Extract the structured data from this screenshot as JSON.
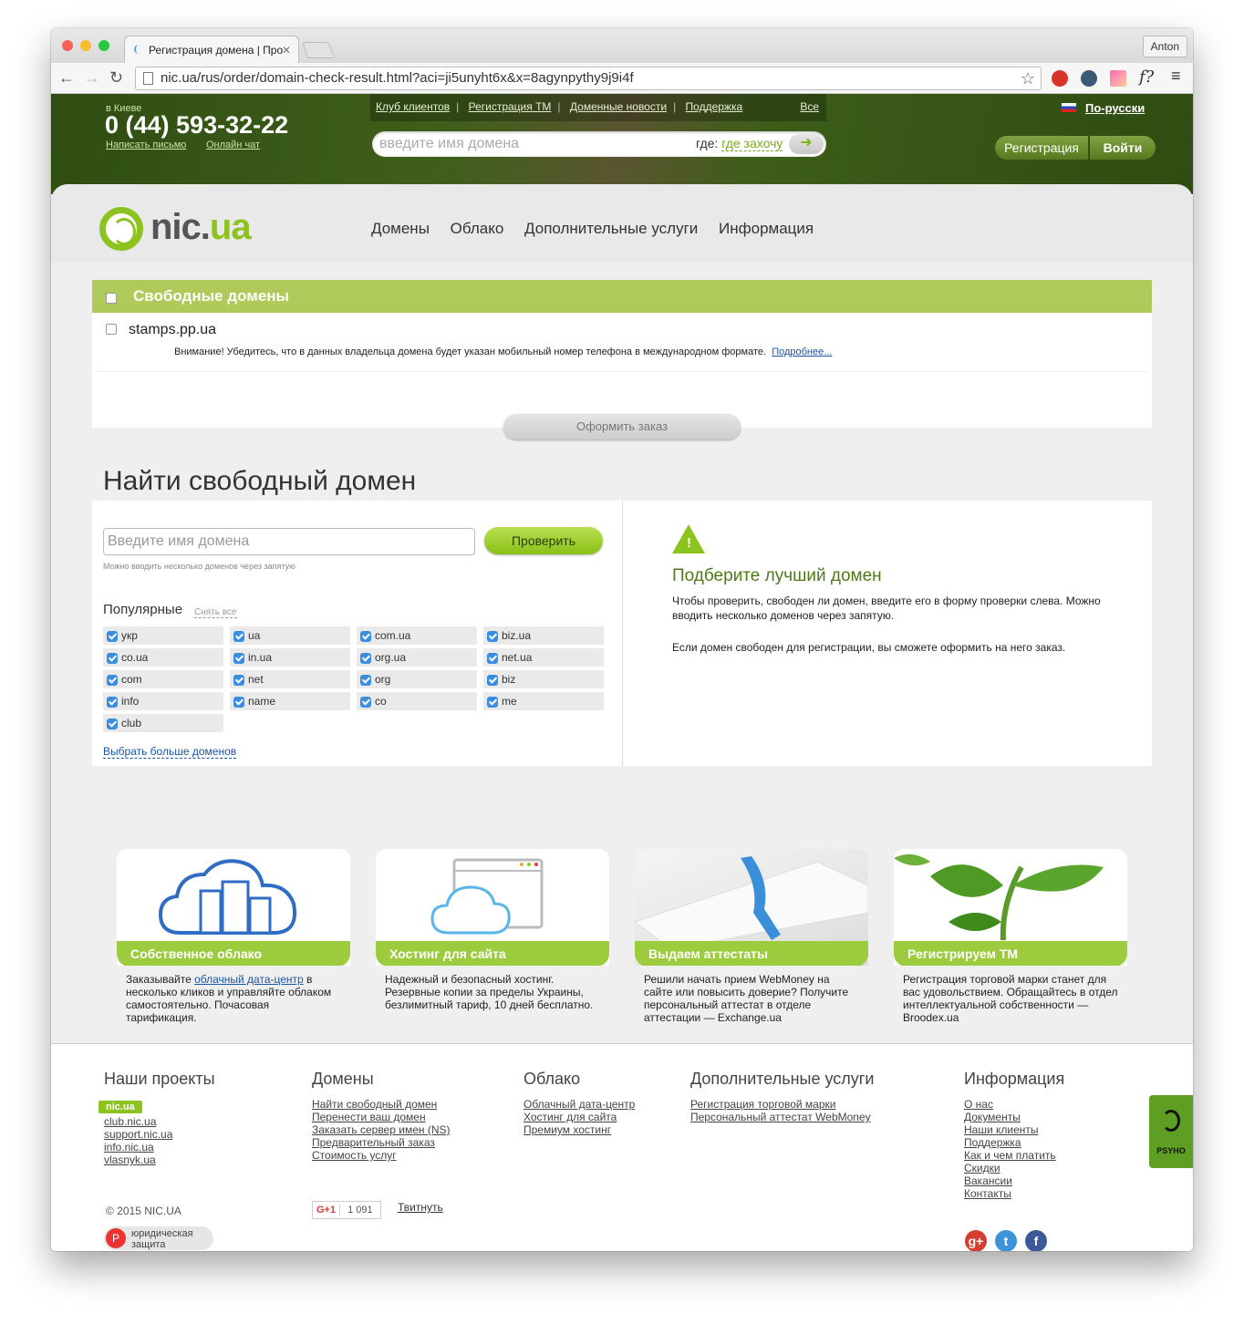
{
  "browser": {
    "tab_title": "Регистрация домена | Про",
    "user": "Anton",
    "url": "nic.ua/rus/order/domain-check-result.html?aci=ji5unyht6x&x=8agynpythy9j9i4f"
  },
  "header": {
    "city": "в Киеве",
    "phone": "0 (44) 593-32-22",
    "write_link": "Написать письмо",
    "chat_link": "Онлайн чат",
    "top_links": [
      "Клуб клиентов",
      "Регистрация ТМ",
      "Доменные новости",
      "Поддержка"
    ],
    "all_link": "Все",
    "search_placeholder": "введите имя домена",
    "where_label": "где:",
    "where_value": "где захочу",
    "language": "По-русски",
    "register": "Регистрация",
    "login": "Войти"
  },
  "nav": {
    "logo_main": "nic.",
    "logo_accent": "ua",
    "items": [
      "Домены",
      "Облако",
      "Дополнительные услуги",
      "Информация"
    ]
  },
  "free_domains": {
    "title": "Свободные домены",
    "domain": "stamps.pp.ua",
    "warning": "Внимание! Убедитесь, что в данных владельца домена будет указан мобильный номер телефона в международном формате.",
    "more_link": "Подробнее...",
    "order_button": "Оформить заказ"
  },
  "finder": {
    "heading": "Найти свободный домен",
    "input_placeholder": "Введите имя домена",
    "check_button": "Проверить",
    "hint": "Можно вводить несколько доменов через запятую",
    "popular_label": "Популярные",
    "clear_all": "Снять все",
    "zones": [
      [
        "укр",
        "ua",
        "com.ua",
        "biz.ua"
      ],
      [
        "co.ua",
        "in.ua",
        "org.ua",
        "net.ua"
      ],
      [
        "com",
        "net",
        "org",
        "biz"
      ],
      [
        "info",
        "name",
        "co",
        "me"
      ],
      [
        "club"
      ]
    ],
    "more_domains": "Выбрать больше доменов",
    "tip_title": "Подберите лучший домен",
    "tip_text1": "Чтобы проверить, свободен ли домен, введите его в форму проверки слева. Можно вводить несколько доменов через запятую.",
    "tip_text2": "Если домен свободен для регистрации, вы сможете оформить на него заказ."
  },
  "tiles": [
    {
      "title": "Собственное облако",
      "pre": "Заказывайте ",
      "link": "облачный дата-центр",
      "post": " в несколько кликов и управляйте облаком самостоятельно. Почасовая тарификация."
    },
    {
      "title": "Хостинг для сайта",
      "pre": "",
      "link": "",
      "post": "Надежный и безопасный хостинг. Резервные копии за пределы Украины, безлимитный тариф, 10 дней бесплатно."
    },
    {
      "title": "Выдаем аттестаты",
      "pre": "",
      "link": "",
      "post": "Решили начать прием WebMoney на сайте или повысить доверие? Получите персональный аттестат в отделе аттестации — Exchange.ua"
    },
    {
      "title": "Регистрируем ТМ",
      "pre": "",
      "link": "",
      "post": "Регистрация торговой марки станет для вас удовольствием. Обращайтесь в отдел интеллектуальной собственности — Broodex.ua"
    }
  ],
  "footer": {
    "projects_title": "Наши проекты",
    "badge": "nic.ua",
    "projects": [
      "club.nic.ua",
      "support.nic.ua",
      "info.nic.ua",
      "vlasnyk.ua"
    ],
    "domains_title": "Домены",
    "domains": [
      "Найти свободный домен",
      "Перенести ваш домен",
      "Заказать сервер имен (NS)",
      "Предварительный заказ",
      "Стоимость услуг"
    ],
    "cloud_title": "Облако",
    "cloud": [
      "Облачный дата-центр",
      "Хостинг для сайта",
      "Премиум хостинг"
    ],
    "extra_title": "Дополнительные услуги",
    "extra": [
      "Регистрация торговой марки",
      "Персональный аттестат WebMoney"
    ],
    "info_title": "Информация",
    "info": [
      "О нас",
      "Документы",
      "Наши клиенты",
      "Поддержка",
      "Как и чем платить",
      "Скидки",
      "Вакансии",
      "Контакты"
    ],
    "copyright": "© 2015 NIC.UA",
    "legal": "юридическая защита",
    "gplus": "G+1",
    "gplus_count": "1 091",
    "tweet": "Твитнуть",
    "psyho": "PSYHO"
  }
}
